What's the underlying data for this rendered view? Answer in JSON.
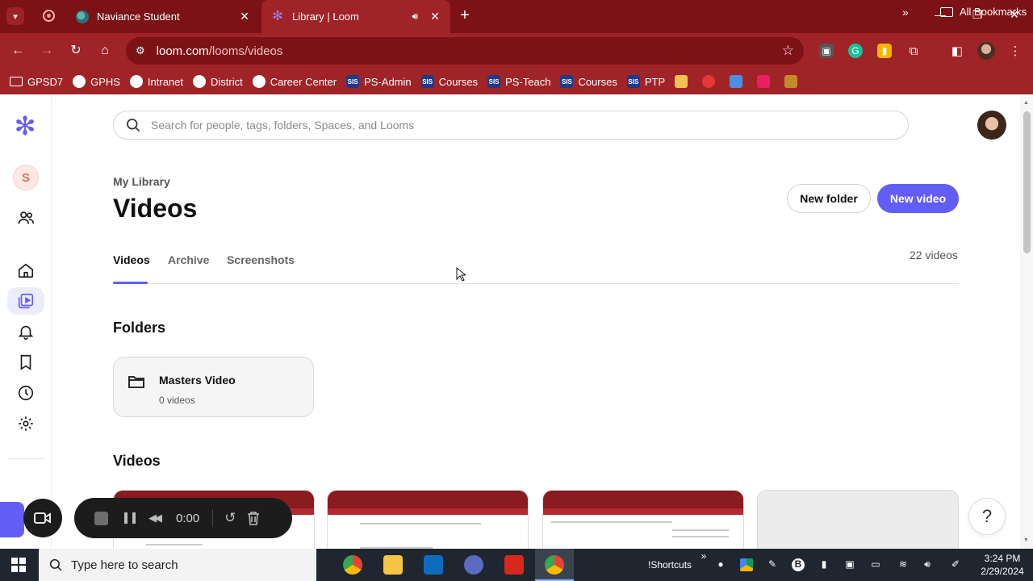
{
  "browser": {
    "tabs": [
      {
        "title": "Naviance Student",
        "favicon": "naviance-icon",
        "active": false
      },
      {
        "title": "Library | Loom",
        "favicon": "loom-icon",
        "active": true,
        "audio": true
      }
    ],
    "url_host": "loom.com",
    "url_path": "/looms/videos",
    "bookmarks": [
      "GPSD7",
      "GPHS",
      "Intranet",
      "District",
      "Career Center",
      "PS-Admin",
      "Courses",
      "PS-Teach",
      "Courses",
      "PTP"
    ],
    "bookmark_icon_types": [
      "folder",
      "globe",
      "globe",
      "globe",
      "globe",
      "sis",
      "sis",
      "sis",
      "sis",
      "sis"
    ],
    "sis_label": "SIS",
    "all_bookmarks": "All Bookmarks",
    "accent_color": "#a02328"
  },
  "loom": {
    "search_placeholder": "Search for people, tags, folders, Spaces, and Looms",
    "workspace_initial": "S",
    "breadcrumb": "My Library",
    "title": "Videos",
    "new_folder": "New folder",
    "new_video": "New video",
    "tabs": [
      "Videos",
      "Archive",
      "Screenshots"
    ],
    "selected_tab": "Videos",
    "video_count": "22 videos",
    "folders_heading": "Folders",
    "folders": [
      {
        "name": "Masters Video",
        "count": "0 videos"
      }
    ],
    "videos_heading": "Videos",
    "brand_color": "#625df5",
    "recorder": {
      "time": "0:00"
    },
    "help": "?"
  },
  "taskbar": {
    "search_placeholder": "Type here to search",
    "shortcuts": "!Shortcuts",
    "time": "3:24 PM",
    "date": "2/29/2024"
  }
}
